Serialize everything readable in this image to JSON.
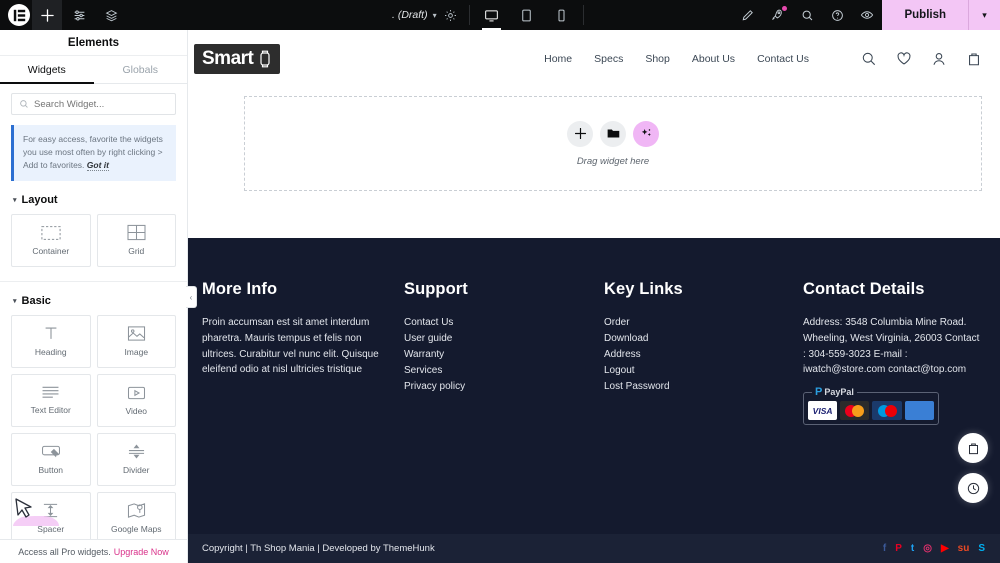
{
  "topbar": {
    "logo_icon": "elementor-logo-icon",
    "add_icon": "plus-icon",
    "settings_icon": "sliders-icon",
    "layers_icon": "layers-icon",
    "draft_label": ". (Draft)",
    "draft_chevron": "▾",
    "page_settings_icon": "gear-icon",
    "responsive": [
      {
        "name": "desktop",
        "icon": "desktop-icon",
        "active": true
      },
      {
        "name": "tablet",
        "icon": "tablet-icon",
        "active": false
      },
      {
        "name": "mobile",
        "icon": "mobile-icon",
        "active": false
      }
    ],
    "right_icons": [
      {
        "name": "edit-pen-icon",
        "badge": false
      },
      {
        "name": "navigator-rocket-icon",
        "badge": true
      },
      {
        "name": "finder-search-icon",
        "badge": false
      },
      {
        "name": "help-icon",
        "badge": false
      },
      {
        "name": "preview-eye-icon",
        "badge": false
      }
    ],
    "publish_label": "Publish",
    "publish_chevron": "▾",
    "publish_color": "#f3c6f5"
  },
  "panel": {
    "header_title": "Elements",
    "tabs": [
      {
        "label": "Widgets",
        "active": true
      },
      {
        "label": "Globals",
        "active": false
      }
    ],
    "search": {
      "placeholder": "Search Widget...",
      "value": "",
      "icon": "search-icon"
    },
    "notice": {
      "text": "For easy access, favorite the widgets you use most often by right clicking > Add to favorites.",
      "action": "Got it",
      "accent": "#2c6fd1"
    },
    "sections": [
      {
        "title": "Layout",
        "caret": "▾",
        "widgets": [
          {
            "label": "Container",
            "icon": "container-icon"
          },
          {
            "label": "Grid",
            "icon": "grid-icon"
          }
        ]
      },
      {
        "title": "Basic",
        "caret": "▾",
        "widgets": [
          {
            "label": "Heading",
            "icon": "heading-t-icon"
          },
          {
            "label": "Image",
            "icon": "image-icon"
          },
          {
            "label": "Text Editor",
            "icon": "text-editor-icon"
          },
          {
            "label": "Video",
            "icon": "video-play-icon"
          },
          {
            "label": "Button",
            "icon": "button-icon"
          },
          {
            "label": "Divider",
            "icon": "divider-icon"
          },
          {
            "label": "Spacer",
            "icon": "spacer-icon"
          },
          {
            "label": "Google Maps",
            "icon": "google-maps-icon"
          }
        ]
      }
    ],
    "pro_bar": {
      "text": "Access all Pro widgets.",
      "link": "Upgrade Now",
      "link_color": "#d9328a"
    },
    "collapse_icon": "chevron-left-icon"
  },
  "canvas": {
    "site_header": {
      "logo_text": "Smart",
      "logo_icon": "smartwatch-icon",
      "nav": [
        "Home",
        "Specs",
        "Shop",
        "About Us",
        "Contact Us"
      ],
      "icons": [
        {
          "name": "search-icon"
        },
        {
          "name": "wishlist-heart-icon"
        },
        {
          "name": "account-user-icon"
        },
        {
          "name": "cart-bag-icon"
        }
      ]
    },
    "dropzone": {
      "label": "Drag widget here",
      "buttons": [
        {
          "name": "add-element-button",
          "icon": "plus-icon"
        },
        {
          "name": "template-library-button",
          "icon": "folder-icon"
        },
        {
          "name": "ai-builder-button",
          "icon": "sparkle-ai-icon",
          "color": "#f0b6f5"
        }
      ]
    },
    "floating_buttons": [
      {
        "name": "floating-cart-button",
        "icon": "bag-icon"
      },
      {
        "name": "floating-recent-button",
        "icon": "clock-icon"
      }
    ]
  },
  "footer": {
    "background": "#141a2e",
    "columns": [
      {
        "title": "More Info",
        "type": "text",
        "body": "Proin accumsan est sit amet interdum pharetra. Mauris tempus et felis non ultrices. Curabitur vel nunc elit. Quisque eleifend odio at nisl ultricies tristique"
      },
      {
        "title": "Support",
        "type": "links",
        "links": [
          "Contact Us",
          "User guide",
          "Warranty",
          "Services",
          "Privacy policy"
        ]
      },
      {
        "title": "Key Links",
        "type": "links",
        "links": [
          "Order",
          "Download",
          "Address",
          "Logout",
          "Lost Password"
        ]
      },
      {
        "title": "Contact Details",
        "type": "text",
        "body": "Address: 3548 Columbia Mine Road. Wheeling, West Virginia, 26003 Contact : 304-559-3023 E-mail : iwatch@store.com contact@top.com",
        "payment": {
          "label": "PayPal",
          "cards": [
            "VISA",
            "MasterCard",
            "Maestro",
            "AMEX"
          ]
        }
      }
    ],
    "bottom": {
      "copyright": "Copyright | Th Shop Mania | Developed by ThemeHunk",
      "socials": [
        {
          "name": "facebook-icon",
          "glyph": "f",
          "color": "#3b5998"
        },
        {
          "name": "pinterest-icon",
          "glyph": "P",
          "color": "#e60023"
        },
        {
          "name": "twitter-icon",
          "glyph": "t",
          "color": "#1da1f2"
        },
        {
          "name": "instagram-icon",
          "glyph": "◎",
          "color": "#e1306c"
        },
        {
          "name": "youtube-icon",
          "glyph": "▶",
          "color": "#ff0000"
        },
        {
          "name": "stumbleupon-icon",
          "glyph": "su",
          "color": "#eb4924"
        },
        {
          "name": "skype-icon",
          "glyph": "S",
          "color": "#00aff0"
        }
      ]
    }
  }
}
